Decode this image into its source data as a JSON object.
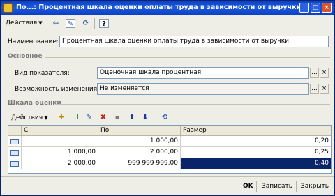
{
  "window": {
    "title": "По...: Процентная шкала оценки оплаты труда в зависимости от выручки",
    "minimize_glyph": "_",
    "maximize_glyph": "□",
    "close_glyph": "×"
  },
  "toolbar": {
    "actions_label": "Действия",
    "icons": [
      "back-icon",
      "write-icon",
      "refresh-icon",
      "help-icon"
    ],
    "help_glyph": "?"
  },
  "form": {
    "name_label": "Наименование:",
    "name_value": "Процентная шкала оценки оплаты труда в зависимости от выручки",
    "section_main": "Основное",
    "indicator_label": "Вид показателя:",
    "indicator_value": "Оценочная шкала процентная",
    "change_label": "Возможность изменения:",
    "change_value": "Не изменяется",
    "dots_glyph": "...",
    "clear_glyph": "×"
  },
  "scale": {
    "section_label": "Шкала оценки",
    "actions_label": "Действия",
    "columns": [
      "С",
      "По",
      "Размер"
    ],
    "rows": [
      {
        "from": "",
        "to": "1 000,00",
        "size": "0,20"
      },
      {
        "from": "1 000,00",
        "to": "2 000,00",
        "size": "0,25"
      },
      {
        "from": "2 000,00",
        "to": "999 999 999,00",
        "size": "0,40"
      }
    ]
  },
  "footer": {
    "ok_label": "OK",
    "save_label": "Записать",
    "close_label": "Закрыть"
  },
  "colors": {
    "title_bar": "#0a3ec8",
    "selection": "#0a246a"
  }
}
